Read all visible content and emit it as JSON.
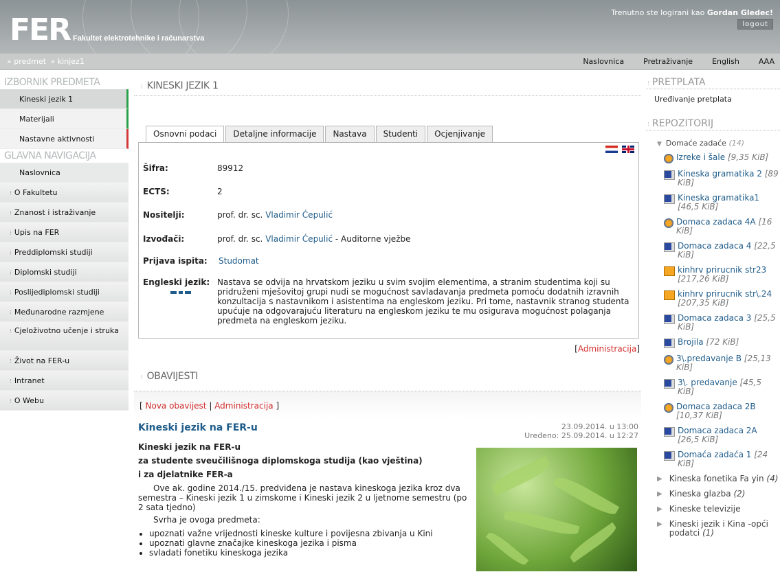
{
  "header": {
    "logo": "FER",
    "faculty": "Fakultet elektrotehnike i računarstva",
    "login_prefix": "Trenutno ste logirani kao",
    "user": "Gordan Gledec!",
    "logout": "logout"
  },
  "breadcrumb": {
    "items": [
      "» predmet",
      "» kinjez1"
    ]
  },
  "topnav": {
    "items": [
      "Naslovnica",
      "Pretraživanje",
      "English",
      "AAA"
    ]
  },
  "sidebar": {
    "izbornik_title": "IZBORNIK PREDMETA",
    "izbornik": [
      "Kineski jezik 1",
      "Materijali",
      "Nastavne aktivnosti"
    ],
    "nav_title": "GLAVNA NAVIGACIJA",
    "nav": [
      "Naslovnica",
      "O Fakultetu",
      "Znanost i istraživanje",
      "Upis na FER",
      "Preddiplomski studiji",
      "Diplomski studiji",
      "Poslijediplomski studiji",
      "Međunarodne razmjene",
      "Cjeloživotno učenje i struka",
      "Život na FER-u",
      "Intranet",
      "O Webu"
    ]
  },
  "course": {
    "title": "KINESKI JEZIK 1",
    "tabs": [
      "Osnovni podaci",
      "Detaljne informacije",
      "Nastava",
      "Studenti",
      "Ocjenjivanje"
    ],
    "sifra_label": "Šifra:",
    "sifra": "89912",
    "ects_label": "ECTS:",
    "ects": "2",
    "nositelji_label": "Nositelji:",
    "nositelji_prefix": "prof. dr. sc.",
    "nositelji_name": "Vladimir Ćepulić",
    "izvodaci_label": "Izvođači:",
    "izvodaci_prefix": "prof. dr. sc.",
    "izvodaci_name": "Vladimir Ćepulić",
    "izvodaci_suffix": "- Auditorne vježbe",
    "prijava_label": "Prijava ispita:",
    "prijava": "Studomat",
    "engleski_label": "Engleski jezik:",
    "engleski_text": "Nastava se odvija na hrvatskom jeziku u svim svojim elementima, a stranim studentima koji su pridruženi mješovitoj grupi nudi se mogućnost savladavanja predmeta pomoću dodatnih izravnih konzultacija s nastavnikom i asistentima na engleskom jeziku. Pri tome, nastavnik stranog studenta upućuje na odgovarajuću literaturu na engleskom jeziku te mu osigurava mogućnost polaganja predmeta na engleskom jeziku.",
    "admin": "Administracija"
  },
  "obavijesti": {
    "title": "OBAVIJESTI",
    "nova": "Nova obavijest",
    "admin": "Administracija",
    "post_title": "Kineski jezik na FER-u",
    "date": "23.09.2014. u 13:00",
    "edited": "Uređeno: 25.09.2014. u 12:27",
    "h1": "Kineski jezik na FER-u",
    "h2": "za studente sveučilišnoga diplomskoga studija (kao vještina)",
    "h3": "i za djelatnike FER-a",
    "p1": "Ove ak. godine 2014./15. predviđena je nastava kineskoga jezika kroz dva semestra – Kineski jezik 1 u zimskome i Kineski jezik 2 u ljetnome semestru (po 2 sata tjedno)",
    "p2": "Svrha je ovoga predmeta:",
    "bullets": [
      "upoznati važne vrijednosti kineske kulture i povijesna zbivanja u Kini",
      "upoznati glavne značajke kineskoga jezika i pisma",
      "svladati fonetiku kineskoga jezika"
    ]
  },
  "right": {
    "pretplata_title": "PRETPLATA",
    "pretplata_link": "Uređivanje pretplata",
    "repo_title": "REPOZITORIJ",
    "folder": "Domaće zadaće",
    "folder_count": "(14)",
    "files": [
      {
        "icon": "firefox-icon",
        "name": "Izreke i šale",
        "size": "[9,35 KiB]"
      },
      {
        "icon": "document-icon",
        "name": "Kineska gramatika 2",
        "size": "[89 KiB]"
      },
      {
        "icon": "document-icon",
        "name": "Kineska gramatika1",
        "size": "[46,5 KiB]"
      },
      {
        "icon": "firefox-icon",
        "name": "Domaca zadaca 4A",
        "size": "[16 KiB]"
      },
      {
        "icon": "document-icon",
        "name": "Domaca zadaca 4",
        "size": "[22,5 KiB]"
      },
      {
        "icon": "archive-icon",
        "name": "kinhrv prirucnik str23",
        "size": "[217,26 KiB]"
      },
      {
        "icon": "archive-icon",
        "name": "kinhrv prirucnik str\\.24",
        "size": "[207,35 KiB]"
      },
      {
        "icon": "document-icon",
        "name": "Domaca zadaca 3",
        "size": "[25,5 KiB]"
      },
      {
        "icon": "document-icon",
        "name": "Brojila",
        "size": "[72 KiB]"
      },
      {
        "icon": "firefox-icon",
        "name": "3\\.predavanje B",
        "size": "[25,13 KiB]"
      },
      {
        "icon": "document-icon",
        "name": "3\\. predavanje",
        "size": "[45,5 KiB]"
      },
      {
        "icon": "firefox-icon",
        "name": "Domaca zadaca 2B",
        "size": "[10,37 KiB]"
      },
      {
        "icon": "document-icon",
        "name": "Domaca zadaca 2A",
        "size": "[26,5 KiB]"
      },
      {
        "icon": "document-icon",
        "name": "Domaća zadaća 1",
        "size": "[24 KiB]"
      }
    ],
    "folders": [
      {
        "name": "Kineska fonetika Fa yin",
        "count": "(4)"
      },
      {
        "name": "Kineska glazba",
        "count": "(2)"
      },
      {
        "name": "Kineske televizije",
        "count": ""
      },
      {
        "name": "Kineski jezik i Kina -opći podatci",
        "count": "(1)"
      }
    ]
  }
}
